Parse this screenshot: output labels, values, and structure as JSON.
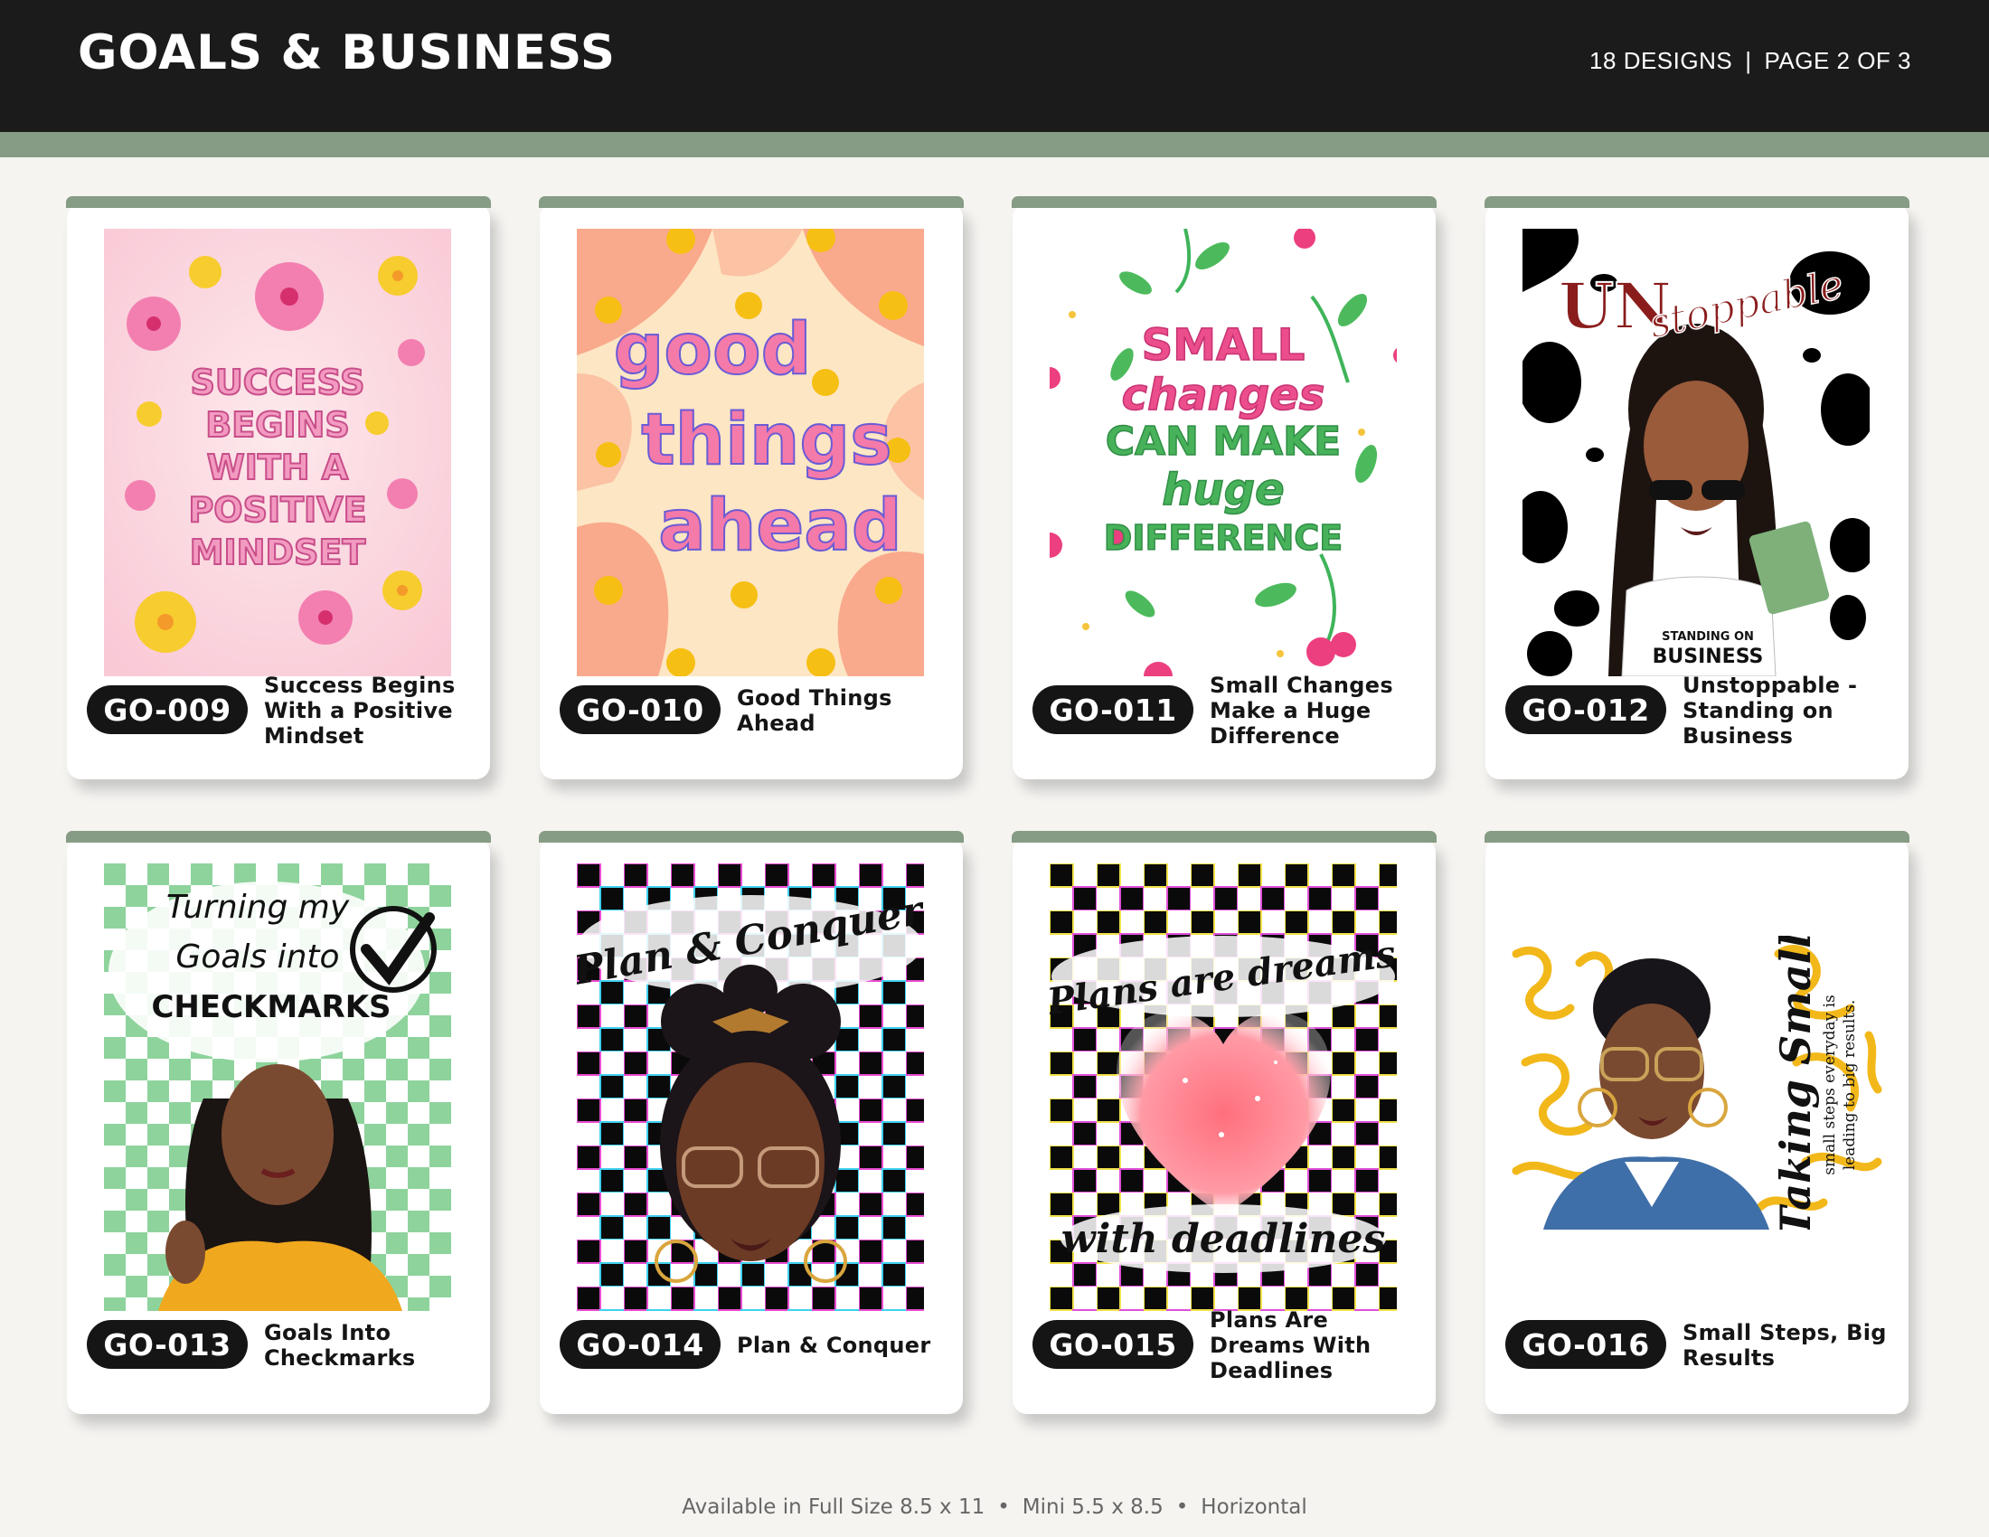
{
  "header": {
    "title": "GOALS & BUSINESS",
    "count": "18 DESIGNS",
    "separator": "|",
    "page": "PAGE 2 OF 3"
  },
  "cards": [
    {
      "code": "GO-009",
      "title": "Success Begins With a Positive Mindset",
      "art_text": [
        "SUCCESS",
        "BEGINS",
        "WITH A",
        "POSITIVE",
        "MINDSET"
      ]
    },
    {
      "code": "GO-010",
      "title": "Good Things Ahead",
      "art_text": [
        "good",
        "things",
        "ahead"
      ]
    },
    {
      "code": "GO-011",
      "title": "Small Changes Make a Huge Difference",
      "art_text": [
        "SMALL",
        "changes",
        "CAN MAKE",
        "huge",
        "DIFFERENCE"
      ]
    },
    {
      "code": "GO-012",
      "title": "Unstoppable - Standing on Business",
      "art_text": [
        "UN",
        "stoppable",
        "STANDING ON",
        "BUSINESS"
      ]
    },
    {
      "code": "GO-013",
      "title": "Goals Into Checkmarks",
      "art_text": [
        "Turning my",
        "Goals into",
        "CHECKMARKS"
      ]
    },
    {
      "code": "GO-014",
      "title": "Plan & Conquer",
      "art_text": [
        "Plan & Conquer"
      ]
    },
    {
      "code": "GO-015",
      "title": "Plans Are Dreams With Deadlines",
      "art_text": [
        "Plans are dreams",
        "with deadlines"
      ]
    },
    {
      "code": "GO-016",
      "title": "Small Steps, Big Results",
      "art_text": [
        "Taking Small",
        "small steps everyday is",
        "leading to big results."
      ]
    }
  ],
  "footer": {
    "full": "Available in Full Size 8.5 x 11",
    "mini": "Mini 5.5 x 8.5",
    "orientation": "Horizontal",
    "bullet": "•"
  },
  "colors": {
    "header_bg": "#1b1b1b",
    "accent": "#869c84",
    "page_bg": "#f5f4f1",
    "pill_bg": "#151515"
  }
}
